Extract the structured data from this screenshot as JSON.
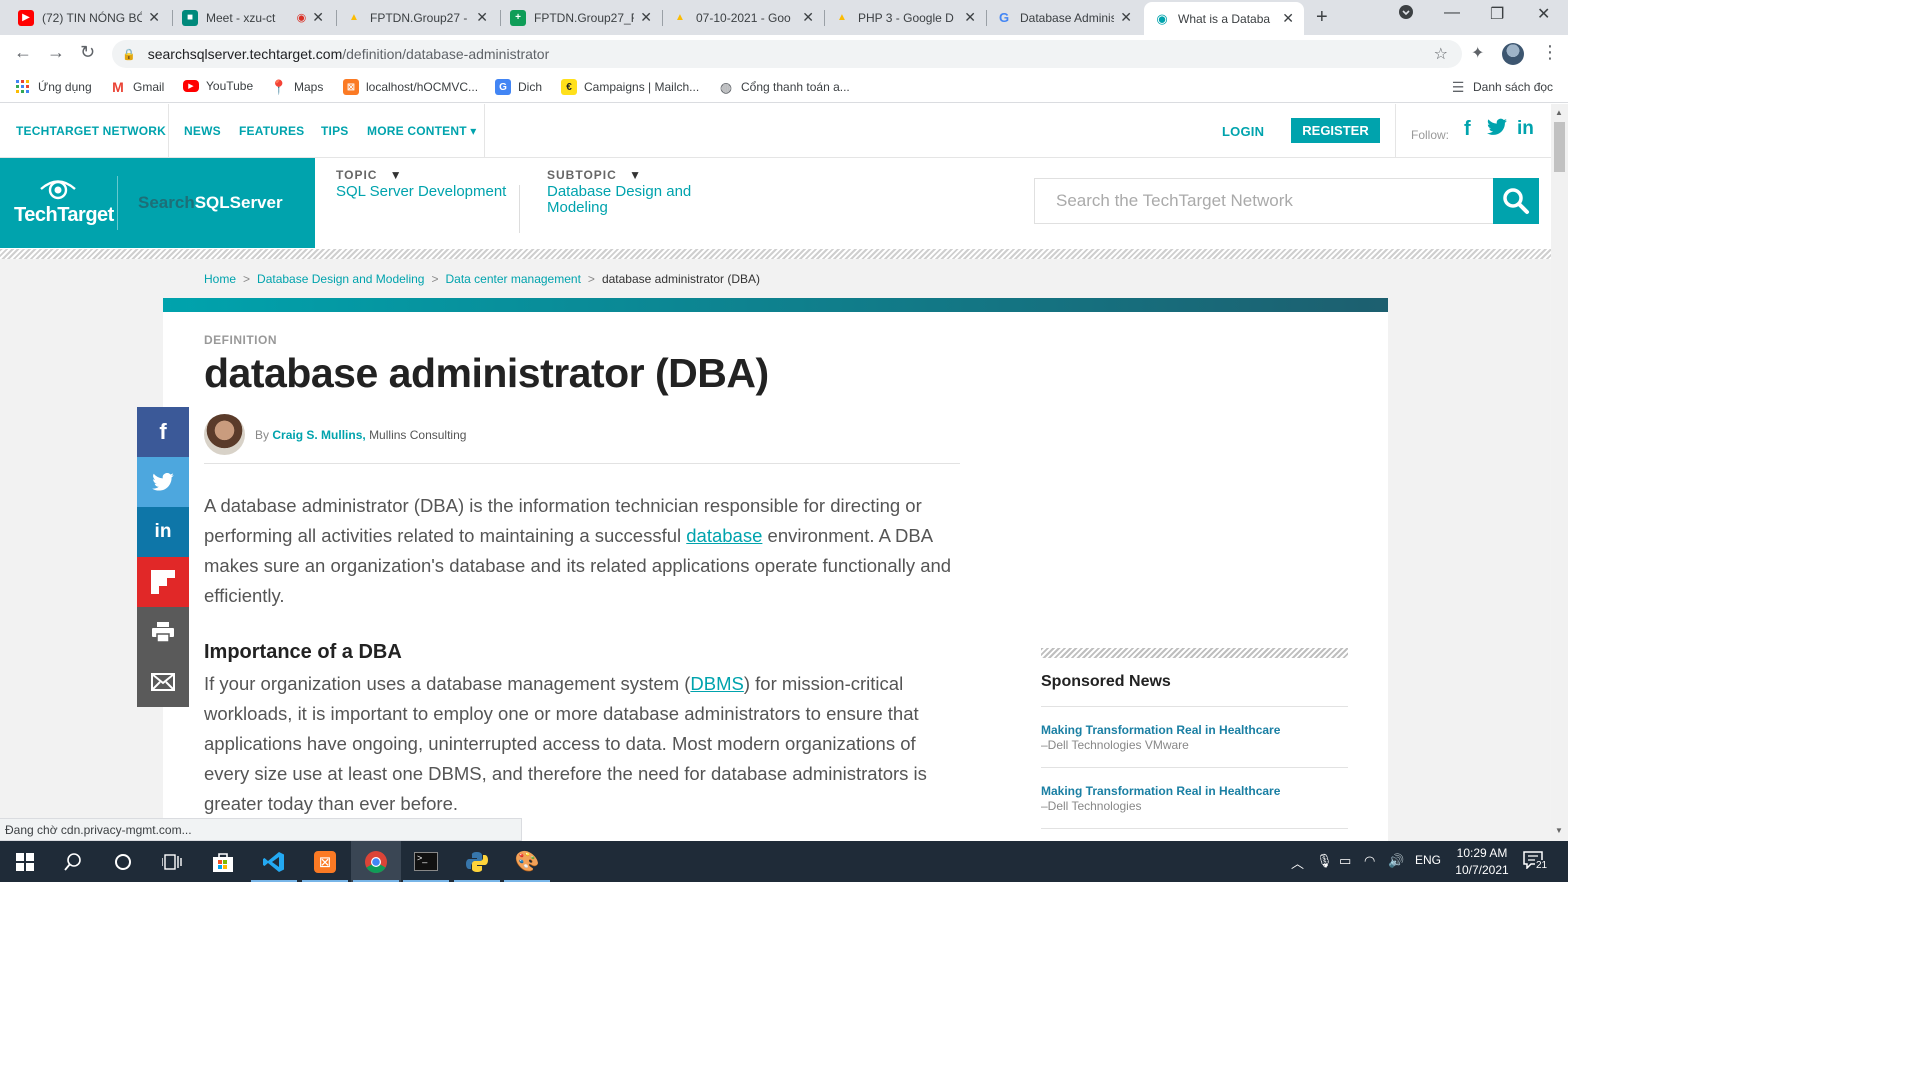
{
  "browser": {
    "tabs": [
      {
        "title": "(72) TIN NÓNG BÓ",
        "icon": "youtube-icon",
        "color": "#ff0000"
      },
      {
        "title": "Meet - xzu-ct",
        "icon": "meet-icon",
        "color": "#00897b"
      },
      {
        "title": "FPTDN.Group27 -",
        "icon": "google-drive-icon",
        "color": "#fbbc04"
      },
      {
        "title": "FPTDN.Group27_F",
        "icon": "google-sheets-icon",
        "color": "#0f9d58"
      },
      {
        "title": "07-10-2021 - Goo",
        "icon": "google-drive-icon",
        "color": "#fbbc04"
      },
      {
        "title": "PHP 3 - Google D",
        "icon": "google-drive-icon",
        "color": "#fbbc04"
      },
      {
        "title": "Database Adminis",
        "icon": "google-icon",
        "color": "#4285f4"
      },
      {
        "title": "What is a Databa",
        "icon": "techtarget-icon",
        "color": "#00a3ad"
      }
    ],
    "address": {
      "domain": "searchsqlserver.techtarget.com",
      "path": "/definition/database-administrator"
    },
    "bookmarks": [
      {
        "label": "Ứng dụng",
        "icon": "apps-grid-icon"
      },
      {
        "label": "Gmail",
        "icon": "gmail-icon"
      },
      {
        "label": "YouTube",
        "icon": "youtube-icon"
      },
      {
        "label": "Maps",
        "icon": "maps-pin-icon"
      },
      {
        "label": "localhost/hOCMVC...",
        "icon": "xampp-icon"
      },
      {
        "label": "Dich",
        "icon": "translate-icon"
      },
      {
        "label": "Campaigns | Mailch...",
        "icon": "mailchimp-icon"
      },
      {
        "label": "Cổng thanh toán a...",
        "icon": "globe-icon"
      }
    ],
    "reading_list": "Danh sách đọc",
    "status": "Đang chờ cdn.privacy-mgmt.com..."
  },
  "nav": {
    "network": "TECHTARGET NETWORK",
    "news": "NEWS",
    "features": "FEATURES",
    "tips": "TIPS",
    "more": "MORE CONTENT ▾",
    "login": "LOGIN",
    "register": "REGISTER",
    "follow": "Follow:"
  },
  "brand": {
    "logo": "TechTarget",
    "site_prefix": "Search",
    "site_name": "SQLServer"
  },
  "topic": {
    "label": "TOPIC",
    "value": "SQL Server Development"
  },
  "subtopic": {
    "label": "SUBTOPIC",
    "value": "Database Design and Modeling"
  },
  "search": {
    "placeholder": "Search the TechTarget Network"
  },
  "breadcrumb": [
    "Home",
    "Database Design and Modeling",
    "Data center management",
    "database administrator (DBA)"
  ],
  "article": {
    "label": "DEFINITION",
    "title": "database administrator (DBA)",
    "by": "By",
    "author": "Craig S. Mullins,",
    "org": "Mullins Consulting",
    "p1_a": "A database administrator (DBA) is the information technician responsible for directing or performing all activities related to maintaining a successful ",
    "p1_link": "database",
    "p1_b": " environment. A DBA makes sure an organization's database and its related applications operate functionally and efficiently.",
    "h2": "Importance of a DBA",
    "p2_a": "If your organization uses a database management system (",
    "p2_link": "DBMS",
    "p2_b": ") for mission-critical workloads, it is important to employ one or more database administrators to ensure that applications have ongoing, uninterrupted access to data. Most modern organizations of every size use at least one DBMS, and therefore the need for database administrators is greater today than ever before."
  },
  "share": [
    {
      "name": "facebook",
      "glyph": "f",
      "color": "#3b5998"
    },
    {
      "name": "twitter",
      "glyph": "🐦",
      "color": "#4da7de"
    },
    {
      "name": "linkedin",
      "glyph": "in",
      "color": "#0e76a8"
    },
    {
      "name": "flipboard",
      "glyph": "F",
      "color": "#e12828"
    },
    {
      "name": "print",
      "glyph": "🖶",
      "color": "#5a5a5a"
    },
    {
      "name": "email",
      "glyph": "✉",
      "color": "#5a5a5a"
    }
  ],
  "sponsored": {
    "heading": "Sponsored News",
    "items": [
      {
        "title": "Making Transformation Real in Healthcare",
        "source": "–Dell Technologies VMware"
      },
      {
        "title": "Making Transformation Real in Healthcare",
        "source": "–Dell Technologies"
      }
    ]
  },
  "taskbar": {
    "lang": "ENG",
    "time": "10:29 AM",
    "date": "10/7/2021",
    "notifications": "21"
  },
  "colors": {
    "accent": "#00a3ad",
    "dark_teal": "#1d5f6f",
    "taskbar": "#1f2b38"
  }
}
